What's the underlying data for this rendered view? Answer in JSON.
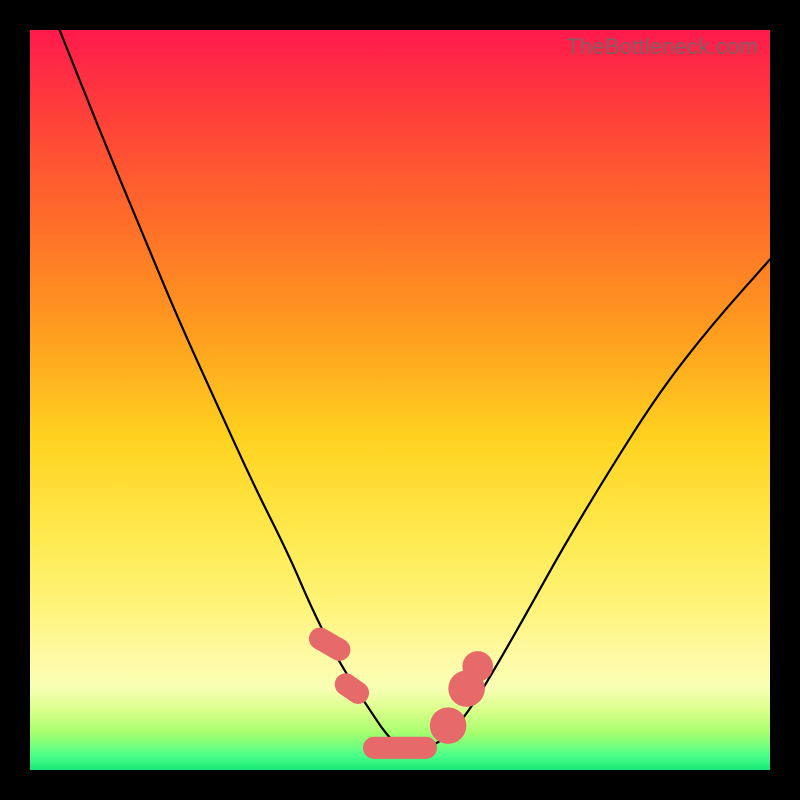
{
  "watermark": "TheBottleneck.com",
  "colors": {
    "curve": "#000000",
    "marker": "#e66a6a",
    "frame_bg": "#000000"
  },
  "chart_data": {
    "type": "line",
    "title": "",
    "xlabel": "",
    "ylabel": "",
    "xlim": [
      0,
      100
    ],
    "ylim": [
      0,
      100
    ],
    "grid": false,
    "legend": false,
    "series": [
      {
        "name": "curve",
        "x": [
          4,
          10,
          15,
          20,
          25,
          30,
          35,
          38,
          41,
          44,
          46,
          48,
          50,
          52,
          54,
          57,
          60,
          63,
          67,
          72,
          78,
          85,
          92,
          100
        ],
        "y": [
          100,
          85,
          73,
          61,
          50,
          39,
          29,
          22,
          16,
          11,
          8,
          5,
          3,
          3,
          3,
          5,
          9,
          14,
          21,
          30,
          40,
          51,
          60,
          69
        ]
      }
    ],
    "markers": [
      {
        "type": "pill",
        "x_center": 40.5,
        "y": 17,
        "w": 3,
        "h": 6,
        "rot": -60
      },
      {
        "type": "pill",
        "x_center": 43.5,
        "y": 11,
        "w": 3,
        "h": 5,
        "rot": -55
      },
      {
        "type": "pill",
        "x_center": 50.0,
        "y": 3,
        "w": 10,
        "h": 3,
        "rot": 0
      },
      {
        "type": "dot",
        "x": 56.5,
        "y": 6,
        "r": 2.2
      },
      {
        "type": "dot",
        "x": 59.0,
        "y": 11,
        "r": 2.2
      },
      {
        "type": "dot",
        "x": 60.5,
        "y": 14,
        "r": 1.8
      }
    ],
    "gradient_stops": [
      {
        "pos": 0,
        "color": "#ff1a4d"
      },
      {
        "pos": 10,
        "color": "#ff3b3b"
      },
      {
        "pos": 25,
        "color": "#ff6a2a"
      },
      {
        "pos": 40,
        "color": "#ff9a1f"
      },
      {
        "pos": 55,
        "color": "#ffd21f"
      },
      {
        "pos": 68,
        "color": "#ffe94d"
      },
      {
        "pos": 78,
        "color": "#fff47a"
      },
      {
        "pos": 85,
        "color": "#fffaa6"
      },
      {
        "pos": 89,
        "color": "#f7ffb3"
      },
      {
        "pos": 92,
        "color": "#d9ff8a"
      },
      {
        "pos": 95,
        "color": "#a6ff6e"
      },
      {
        "pos": 98,
        "color": "#4dff8a"
      },
      {
        "pos": 100,
        "color": "#17e876"
      }
    ]
  }
}
